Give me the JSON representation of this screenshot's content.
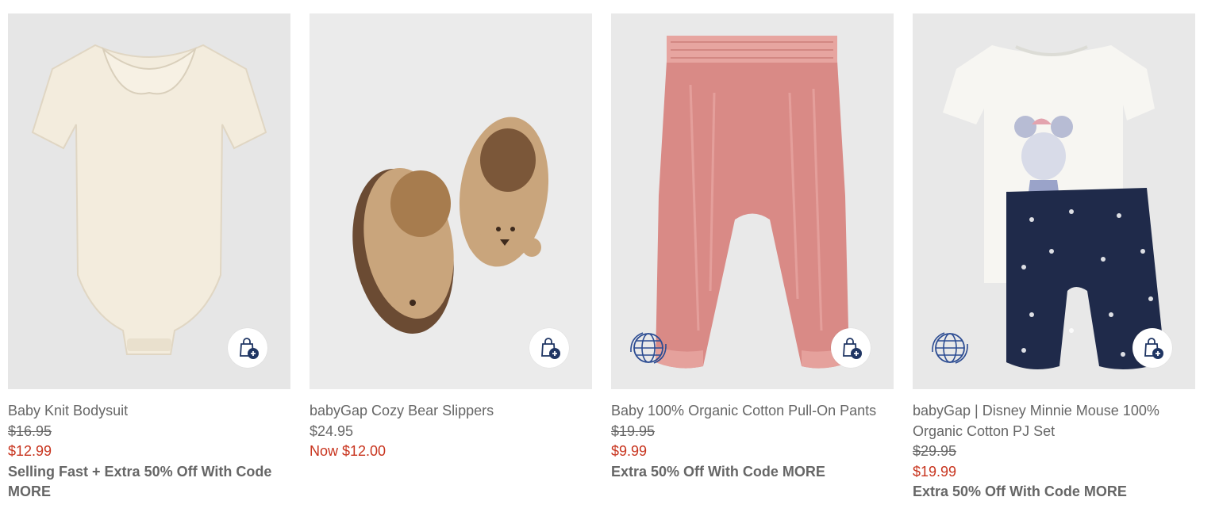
{
  "colors": {
    "sale_price": "#c8341e",
    "text": "#666666",
    "icon_navy": "#1f3563"
  },
  "icons": {
    "bag": "shopping-bag-plus-icon",
    "globe": "globe-sustainability-icon"
  },
  "products": [
    {
      "name": "Baby Knit Bodysuit",
      "original_price": "$16.95",
      "sale_price": "$12.99",
      "promo": "Selling Fast + Extra 50% Off With Code MORE"
    },
    {
      "name": "babyGap Cozy Bear Slippers",
      "price": "$24.95",
      "now_price": "Now $12.00"
    },
    {
      "name": "Baby 100% Organic Cotton Pull-On Pants",
      "original_price": "$19.95",
      "sale_price": "$9.99",
      "promo": "Extra 50% Off With Code MORE"
    },
    {
      "name": "babyGap | Disney Minnie Mouse 100% Organic Cotton PJ Set",
      "original_price": "$29.95",
      "sale_price": "$19.99",
      "promo": "Extra 50% Off With Code MORE"
    }
  ]
}
